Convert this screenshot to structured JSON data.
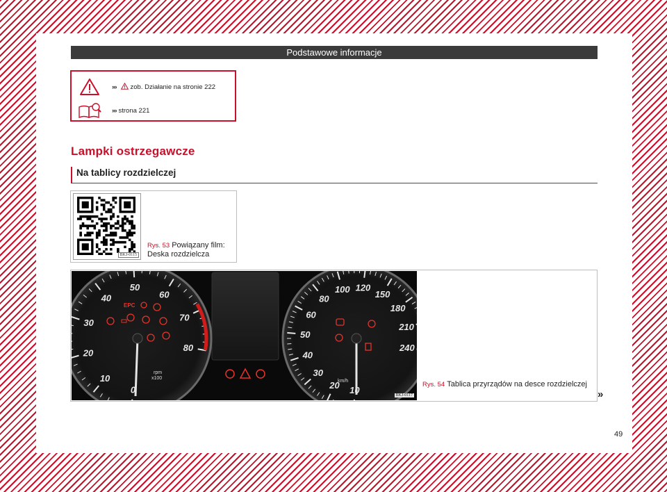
{
  "header": {
    "title": "Podstawowe informacje"
  },
  "notes": [
    {
      "icon": "warning-triangle-icon",
      "arrows": "›››",
      "text": "zob. Działanie na stronie 222"
    },
    {
      "icon": "book-magnifier-icon",
      "arrows": "›››",
      "text": "strona 221"
    }
  ],
  "section": {
    "title": "Lampki ostrzegawcze"
  },
  "subsection": {
    "title": "Na tablicy rozdzielczej"
  },
  "figure53": {
    "label": "Rys. 53",
    "caption": "Powiązany film: Deska rozdzielcza",
    "code": "BKJ-0115"
  },
  "figure54": {
    "label": "Rys. 54",
    "caption": "Tablica przyrządów na desce rozdziel­czej",
    "code": "BKJ-0117",
    "tachometer": {
      "labels": [
        "0",
        "10",
        "20",
        "30",
        "40",
        "50",
        "60",
        "70",
        "80"
      ],
      "unit_top": "rpm",
      "unit_bottom": "x100"
    },
    "speedometer": {
      "labels": [
        "10",
        "20",
        "30",
        "40",
        "50",
        "60",
        "80",
        "100",
        "120",
        "150",
        "180",
        "210",
        "240"
      ],
      "unit": "km/h"
    },
    "tach_badge": "EPC"
  },
  "continuation": "»",
  "page_number": "49",
  "colors": {
    "accent": "#c9102a",
    "header_bg": "#3b3b3b",
    "warning_lamp": "#e8332a"
  }
}
